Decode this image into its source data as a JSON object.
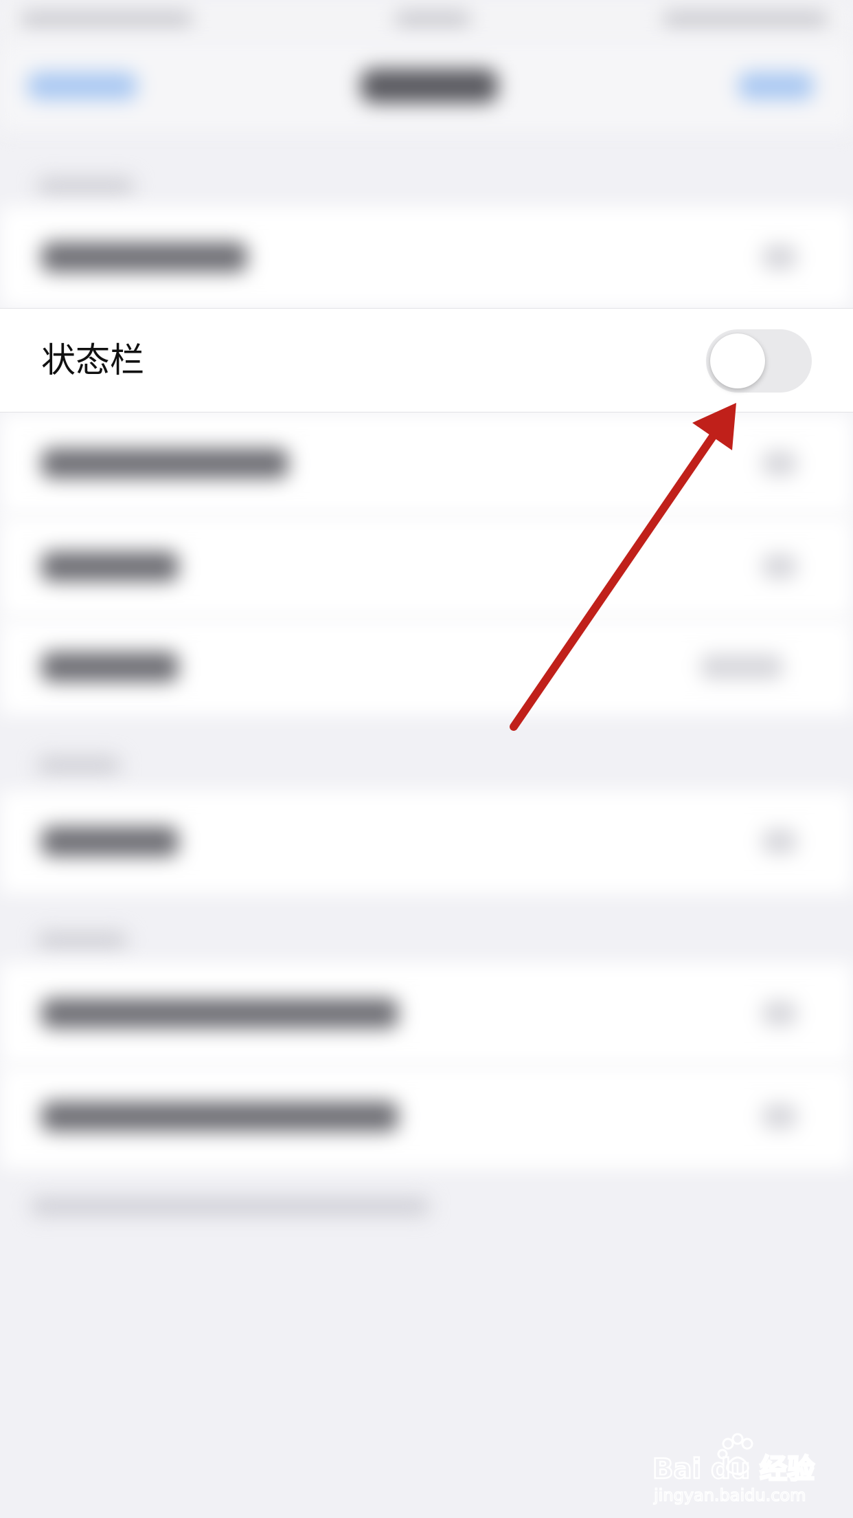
{
  "settings": {
    "focused_row": {
      "label": "状态栏",
      "toggle_on": false
    }
  },
  "colors": {
    "toggle_track_off": "#e9e9eb",
    "annotation_arrow": "#c0201a",
    "background": "#f1f1f5"
  },
  "watermark": {
    "brand": "Bai du 经验",
    "url": "jingyan.baidu.com"
  }
}
